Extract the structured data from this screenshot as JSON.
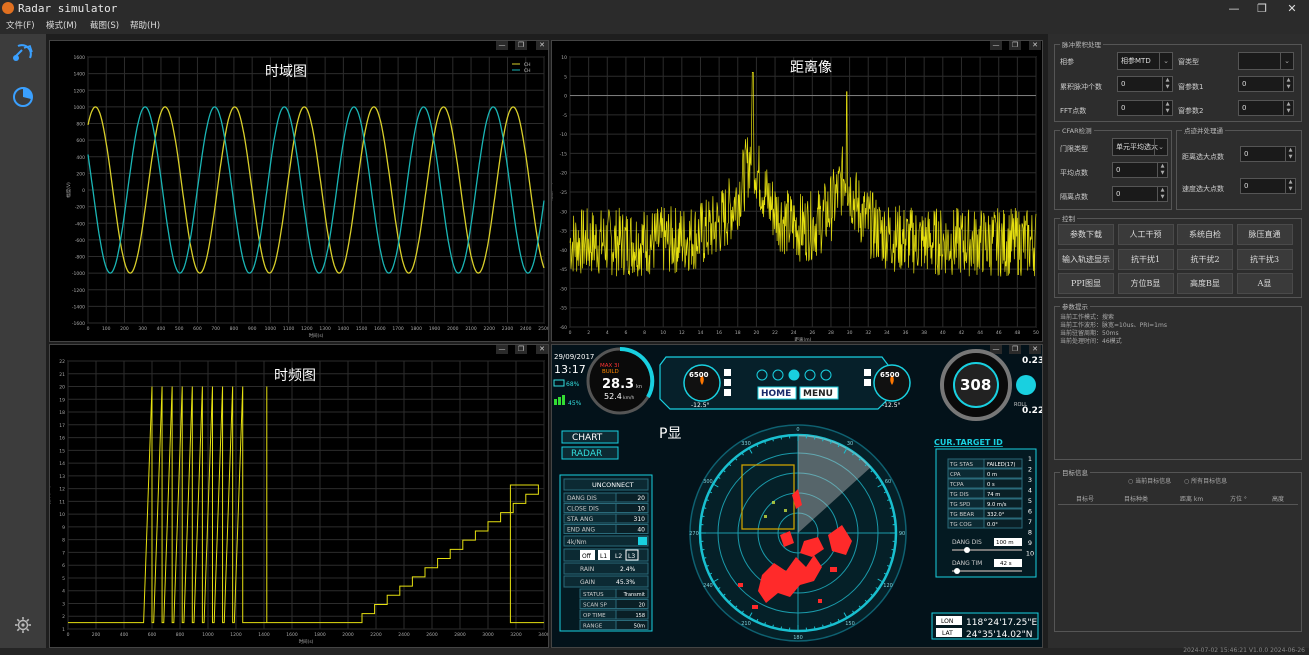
{
  "window": {
    "title": "Radar simulator",
    "controls": [
      "—",
      "❐",
      "✕"
    ]
  },
  "menu": [
    "文件(F)",
    "模式(M)",
    "截图(S)",
    "帮助(H)"
  ],
  "panels": {
    "time_domain": {
      "title": "时域图",
      "legend": [
        "CH",
        "CH"
      ],
      "ylabel": "幅度(V)",
      "xlabel": "时间(s)",
      "yticks": [
        "1600",
        "1400",
        "1200",
        "1000",
        "800",
        "600",
        "400",
        "200",
        "0",
        "-200",
        "-400",
        "-600",
        "-800",
        "-1000",
        "-1200",
        "-1400",
        "-1600"
      ],
      "xticks": [
        "0",
        "100",
        "200",
        "300",
        "400",
        "500",
        "600",
        "700",
        "800",
        "900",
        "1000",
        "1100",
        "1200",
        "1300",
        "1400",
        "1500",
        "1600",
        "1700",
        "1800",
        "1900",
        "2000",
        "2100",
        "2200",
        "2300",
        "2400",
        "2500"
      ],
      "colors": {
        "ch1": "#d9cf2a",
        "ch2": "#1ab5b5"
      }
    },
    "range_profile": {
      "title": "距离像",
      "ylabel": "幅度(dB)",
      "xlabel": "距离(m)",
      "yticks": [
        "10",
        "5",
        "0",
        "-5",
        "-10",
        "-15",
        "-20",
        "-25",
        "-30",
        "-35",
        "-40",
        "-45",
        "-50",
        "-55",
        "-60"
      ],
      "xticks": [
        "0",
        "2",
        "4",
        "6",
        "8",
        "10",
        "12",
        "14",
        "16",
        "18",
        "20",
        "22",
        "24",
        "26",
        "28",
        "30",
        "32",
        "34",
        "36",
        "38",
        "40",
        "42",
        "44",
        "46",
        "48",
        "50"
      ],
      "color": "#e6e010"
    },
    "time_freq": {
      "title": "时频图",
      "ylabel": "频率(Hz)",
      "xlabel": "时间(s)",
      "yticks": [
        "22",
        "21",
        "20",
        "19",
        "18",
        "17",
        "16",
        "15",
        "14",
        "13",
        "12",
        "11",
        "10",
        "9",
        "8",
        "7",
        "6",
        "5",
        "4",
        "3",
        "2",
        "1"
      ],
      "xticks": [
        "0",
        "200",
        "400",
        "600",
        "800",
        "1000",
        "1200",
        "1400",
        "1600",
        "1800",
        "2000",
        "2200",
        "2400",
        "2600",
        "2800",
        "3000",
        "3200",
        "3400"
      ],
      "color": "#e6e010"
    },
    "ppi": {
      "title": "P显"
    }
  },
  "ppi_hud": {
    "date": "29/09/2017",
    "time": "13:17",
    "battery": "68%",
    "signal": "45%",
    "speed_value": "28.3",
    "speed_unit": "kn",
    "speed_sub": "52.4",
    "speed_sub_unit": "km/h",
    "max_label": "MAX 3I",
    "mode_label": "BUILD",
    "gauge_left_value": "6500",
    "gauge_left_angle": "-12.5°",
    "gauge_right_value": "6500",
    "gauge_right_angle": "-12.5°",
    "heading": "308",
    "roll_top": "0.23°",
    "roll_bottom": "0.22°",
    "roll_label": "ROLL",
    "btn_home": "HOME",
    "btn_menu": "MENU",
    "btn_chart": "CHART",
    "btn_radar": "RADAR",
    "unconnect": "UNCONNECT",
    "left_table": [
      {
        "k": "DANG DIS",
        "v": "20"
      },
      {
        "k": "CLOSE DIS",
        "v": "10"
      },
      {
        "k": "STA ANG",
        "v": "310"
      },
      {
        "k": "END ANG",
        "v": "40"
      }
    ],
    "dropdown_value": "4k/Nm",
    "toggle_off": "Off",
    "toggle_l1": "L1",
    "toggle_l2": "L2",
    "toggle_l3": "L3",
    "rain_label": "RAIN",
    "rain_value": "2.4%",
    "gain_label": "GAIN",
    "gain_value": "45.3%",
    "status_table": [
      {
        "k": "STATUS",
        "v": "Transmit"
      },
      {
        "k": "SCAN SP",
        "v": "20"
      },
      {
        "k": "OP TIME",
        "v": "158"
      },
      {
        "k": "RANGE",
        "v": "50m"
      }
    ],
    "target_title": "CUR.TARGET ID",
    "target_table": [
      {
        "k": "TG STAS",
        "v": "FAILED(17)"
      },
      {
        "k": "CPA",
        "v": "0 m"
      },
      {
        "k": "TCPA",
        "v": "0 s"
      },
      {
        "k": "TG DIS",
        "v": "74 m"
      },
      {
        "k": "TG SPD",
        "v": "9.0 m/s"
      },
      {
        "k": "TG BEAR",
        "v": "332.0°"
      },
      {
        "k": "TG COG",
        "v": "0.0°"
      }
    ],
    "target_ids": [
      "1",
      "2",
      "3",
      "4",
      "5",
      "6",
      "7",
      "8",
      "9",
      "10"
    ],
    "dang_dis_label": "DANG DIS",
    "dang_dis_value": "100 m",
    "dang_tim_label": "DANG TIM",
    "dang_tim_value": "42 s",
    "lon_label": "LON",
    "lon_value": "118°24'17.25\"E",
    "lat_label": "LAT",
    "lat_value": "24°35'14.02\"N",
    "compass_labels": [
      "0",
      "30",
      "60",
      "90",
      "120",
      "150",
      "180",
      "210",
      "240",
      "270",
      "300",
      "330"
    ]
  },
  "right_panel": {
    "pulse_group": "脉冲累积处理",
    "f_phase": "相参",
    "f_phase_value": "相参MTD",
    "f_window": "窗类型",
    "f_window_value": "",
    "f_accum": "累积脉冲个数",
    "f_accum_value": "0",
    "f_wparam1": "窗参数1",
    "f_wparam1_value": "0",
    "f_fft": "FFT点数",
    "f_fft_value": "0",
    "f_wparam2": "窗参数2",
    "f_wparam2_value": "0",
    "cfar_group": "CFAR检测",
    "f_thresh": "门限类型",
    "f_thresh_value": "单元平均选大",
    "f_avg": "平均点数",
    "f_avg_value": "0",
    "f_guard": "隔离点数",
    "f_guard_value": "0",
    "trace_group": "点迹并处理通",
    "f_range_sel": "距离选大点数",
    "f_range_sel_value": "0",
    "f_speed_sel": "速度选大点数",
    "f_speed_sel_value": "0",
    "control_group": "控制",
    "buttons": [
      "参数下载",
      "人工干预",
      "系统自检",
      "脉压直通",
      "输入轨迹显示",
      "抗干扰1",
      "抗干扰2",
      "抗干扰3",
      "PPI图显",
      "方位B显",
      "高度B显",
      "A显"
    ],
    "params_group": "参数提示",
    "params_lines": [
      "当前工作模式：搜索",
      "当前工作波形：脉宽=10us、PRI=1ms",
      "当前驻留周期：50ms",
      "当前处理时间：46模式"
    ],
    "target_group": "目标信息",
    "target_radio1": "当前目标信息",
    "target_radio2": "所有目标信息",
    "target_cols": [
      "目标号",
      "目标种类",
      "距离 km",
      "方位 °",
      "高度"
    ]
  },
  "status_bar": "2024-07-02 15:46:21  V1.0.0  2024-06-26"
}
